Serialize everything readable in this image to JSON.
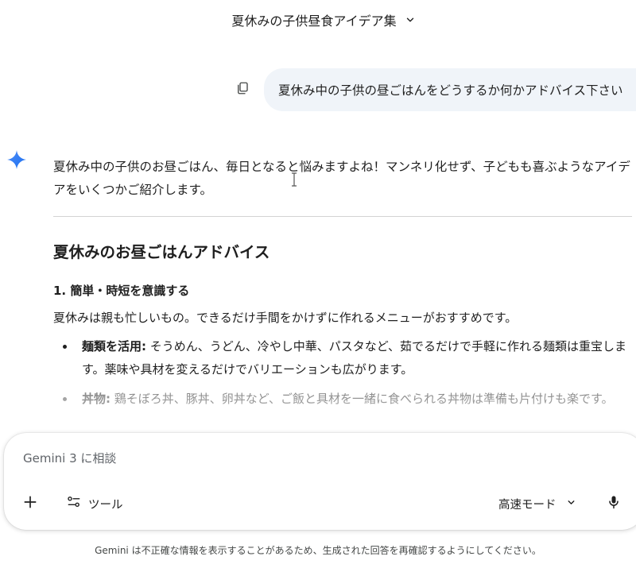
{
  "header": {
    "chat_title": "夏休みの子供昼食アイデア集",
    "chevron_icon": "chevron-down-icon"
  },
  "user_message": {
    "text": "夏休み中の子供の昼ごはんをどうするか何かアドバイス下さい",
    "copy_icon": "copy-icon",
    "bubble_color": "#f0f4f9"
  },
  "response": {
    "avatar_icon": "gemini-sparkle-icon",
    "intro": "夏休み中の子供のお昼ごはん、毎日となると悩みますよね！マンネリ化せず、子どもも喜ぶようなアイデアをいくつかご紹介します。",
    "section_heading": "夏休みのお昼ごはんアドバイス",
    "subheading": "1. 簡単・時短を意識する",
    "sub_desc": "夏休みは親も忙しいもの。できるだけ手間をかけずに作れるメニューがおすすめです。",
    "tips": [
      {
        "label": "麺類を活用:",
        "text": " そうめん、うどん、冷やし中華、パスタなど、茹でるだけで手軽に作れる麺類は重宝します。薬味や具材を変えるだけでバリエーションも広がります。"
      },
      {
        "label": "丼物:",
        "text": " 鶏そぼろ丼、豚丼、卵丼など、ご飯と具材を一緒に食べられる丼物は準備も片付けも楽です。"
      }
    ]
  },
  "input": {
    "placeholder": "Gemini 3 に相談",
    "value": "",
    "add_icon": "plus-icon",
    "tools_label": "ツール",
    "tools_icon": "tools-icon",
    "mode_label": "高速モード",
    "mode_icon": "chevron-down-icon",
    "mic_icon": "microphone-icon"
  },
  "disclaimer": "Gemini は不正確な情報を表示することがあるため、生成された回答を再確認するようにしてください。",
  "colors": {
    "accent_blue": "#4285f4",
    "text_primary": "#1f1f1f",
    "text_secondary": "#444746"
  }
}
